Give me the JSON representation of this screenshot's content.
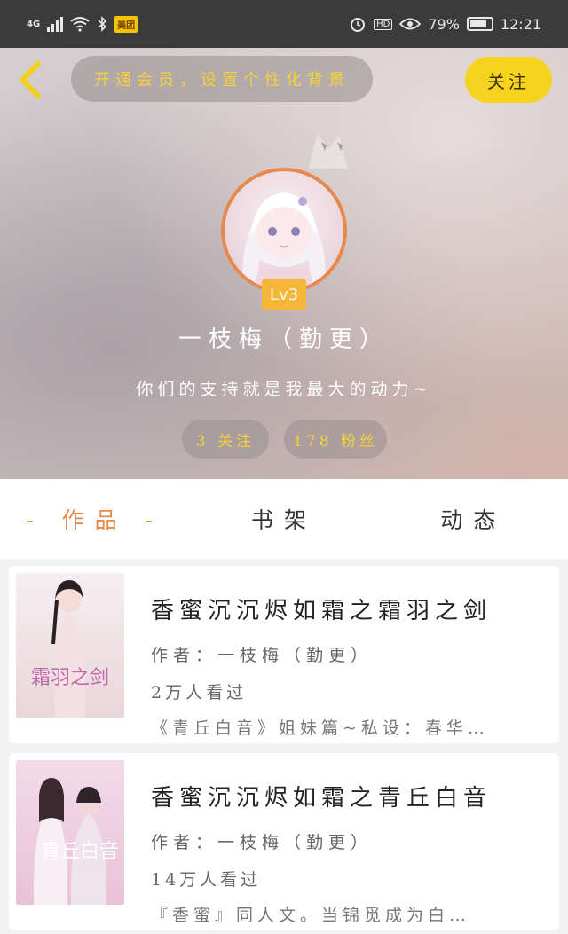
{
  "status_bar": {
    "network": "4G",
    "app_badge": "美团",
    "hd": "HD",
    "battery_percent": "79%",
    "time": "12:21",
    "icons": [
      "signal-icon",
      "wifi-icon",
      "bluetooth-icon",
      "alarm-icon",
      "eye-icon",
      "battery-icon"
    ]
  },
  "header": {
    "back_icon": "chevron-left-icon",
    "vip_prompt": "开通会员，设置个性化背景",
    "follow_label": "关注"
  },
  "profile": {
    "level": "Lv3",
    "name": "一枝梅（勤更）",
    "bio": "你们的支持就是我最大的动力~",
    "following": "3 关注",
    "fans": "178 粉丝"
  },
  "tabs": [
    {
      "label": "- 作品 -",
      "active": true
    },
    {
      "label": "书架",
      "active": false
    },
    {
      "label": "动态",
      "active": false
    }
  ],
  "works": [
    {
      "title": "香蜜沉沉烬如霜之霜羽之剑",
      "author": "作者：一枝梅（勤更）",
      "views": "2万人看过",
      "description": "《青丘白音》姐妹篇~私设：春华…",
      "cover_text": "霜羽之剑"
    },
    {
      "title": "香蜜沉沉烬如霜之青丘白音",
      "author": "作者：一枝梅（勤更）",
      "views": "14万人看过",
      "description": "『香蜜』同人文。当锦觅成为白…",
      "cover_text": "青丘白音"
    }
  ],
  "colors": {
    "accent": "#e88848",
    "yellow": "#f6d31e",
    "level_badge": "#f5b63a"
  }
}
